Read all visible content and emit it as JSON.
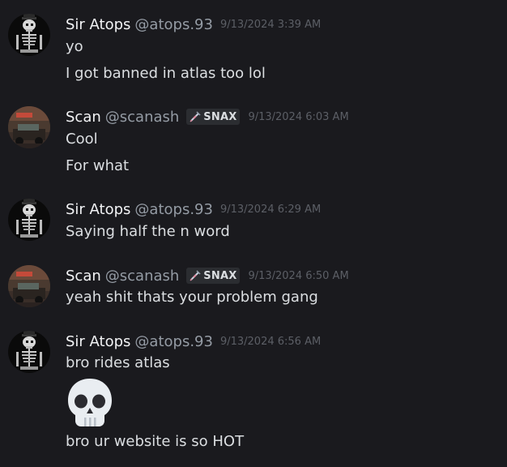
{
  "colors": {
    "background": "#1a1a1e",
    "name": "#f2f3f5",
    "handle": "#949ba4",
    "timestamp": "#5c5f66",
    "text": "#dbdee1"
  },
  "messages": [
    {
      "display_name": "Sir Atops",
      "handle": "@atops.93",
      "timestamp": "9/13/2024 3:39 AM",
      "avatar_icon": "skeleton-avatar-icon",
      "lines": [
        "yo",
        "I got banned in atlas too lol"
      ]
    },
    {
      "display_name": "Scan",
      "handle": "@scanash",
      "tag": "SNAX",
      "tag_icon": "syringe-icon",
      "timestamp": "9/13/2024 6:03 AM",
      "avatar_icon": "car-avatar-icon",
      "lines": [
        "Cool",
        "For what"
      ]
    },
    {
      "display_name": "Sir Atops",
      "handle": "@atops.93",
      "timestamp": "9/13/2024 6:29 AM",
      "avatar_icon": "skeleton-avatar-icon",
      "lines": [
        "Saying half the n word"
      ]
    },
    {
      "display_name": "Scan",
      "handle": "@scanash",
      "tag": "SNAX",
      "tag_icon": "syringe-icon",
      "timestamp": "9/13/2024 6:50 AM",
      "avatar_icon": "car-avatar-icon",
      "lines": [
        "yeah shit thats your problem gang"
      ]
    },
    {
      "display_name": "Sir Atops",
      "handle": "@atops.93",
      "timestamp": "9/13/2024 6:56 AM",
      "avatar_icon": "skeleton-avatar-icon",
      "lines": [
        "bro rides atlas",
        "bro ur website is so HOT"
      ],
      "emoji": "skull-emoji-icon"
    }
  ]
}
